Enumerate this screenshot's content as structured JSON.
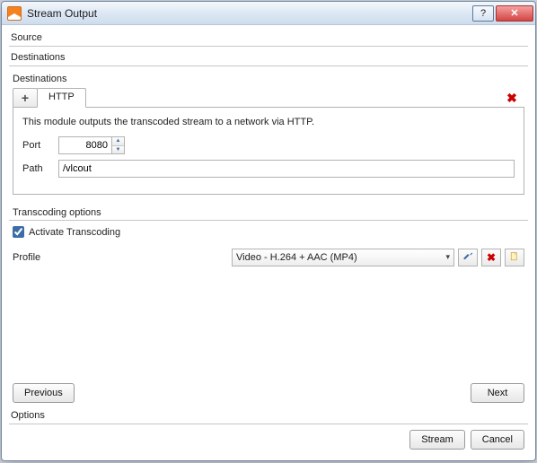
{
  "window": {
    "title": "Stream Output"
  },
  "sections": {
    "source": "Source",
    "destinations": "Destinations",
    "options": "Options"
  },
  "destinations": {
    "group_label": "Destinations",
    "tabs": {
      "http": "HTTP"
    },
    "description": "This module outputs the transcoded stream to a network via HTTP.",
    "port_label": "Port",
    "port_value": "8080",
    "path_label": "Path",
    "path_value": "/vlcout"
  },
  "transcoding": {
    "group_label": "Transcoding options",
    "activate_label": "Activate Transcoding",
    "activate_checked": true,
    "profile_label": "Profile",
    "profile_value": "Video - H.264 + AAC (MP4)"
  },
  "buttons": {
    "previous": "Previous",
    "next": "Next",
    "stream": "Stream",
    "cancel": "Cancel"
  },
  "colors": {
    "accent": "#3b6ea5",
    "danger": "#c00"
  }
}
